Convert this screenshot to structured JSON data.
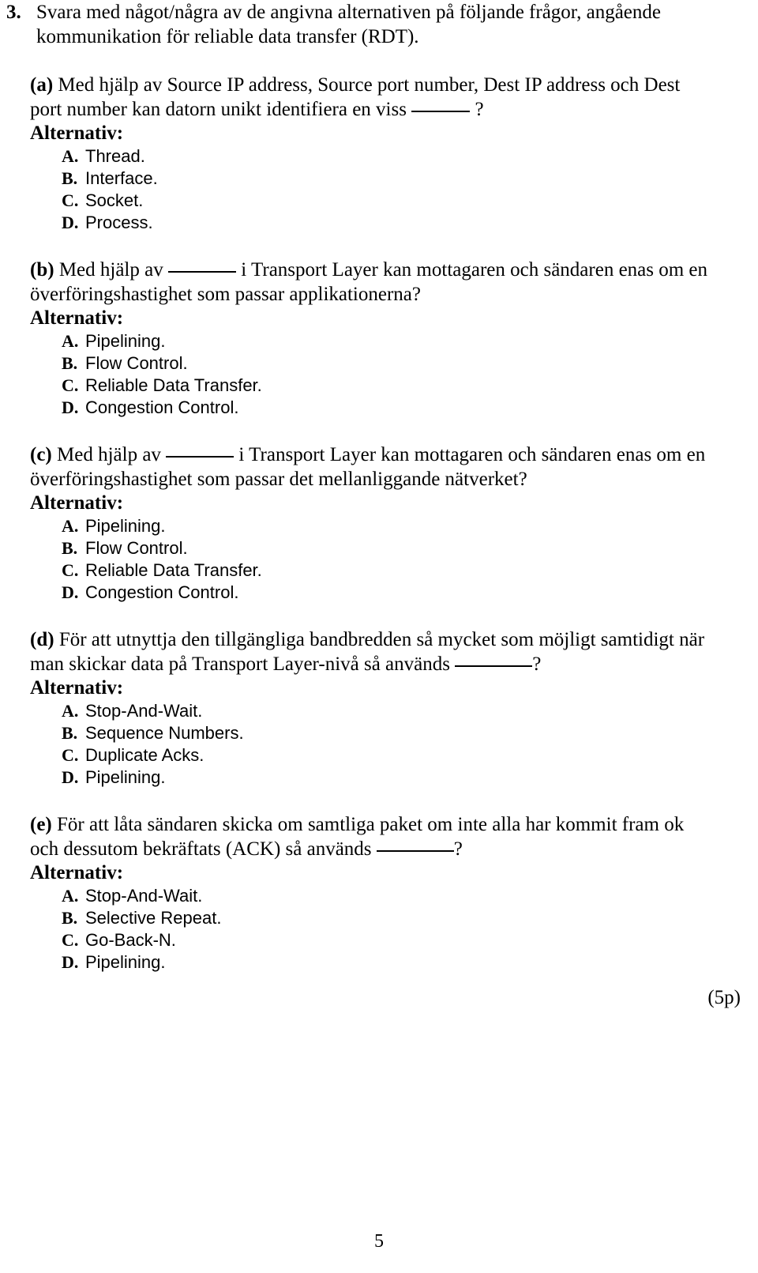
{
  "question": {
    "number": "3.",
    "stem_line1": "Svara med något/några av de angivna alternativen på följande frågor, angående",
    "stem_line2": "kommunikation för reliable data transfer (RDT)."
  },
  "alternativ_label": "Alternativ:",
  "subquestions": [
    {
      "label": "(a)",
      "text_before_blank": " Med hjälp av Source IP address, Source port number, Dest IP address och Dest port number kan datorn unikt identifiera en viss ",
      "text_after_blank": " ?",
      "options": [
        {
          "letter": "A.",
          "text": "Thread."
        },
        {
          "letter": "B.",
          "text": "Interface."
        },
        {
          "letter": "C.",
          "text": "Socket."
        },
        {
          "letter": "D.",
          "text": "Process."
        }
      ]
    },
    {
      "label": "(b)",
      "text_before_blank": " Med hjälp av ",
      "text_after_blank": " i Transport Layer kan mottagaren och sändaren enas om en överföringshastighet som passar applikationerna?",
      "options": [
        {
          "letter": "A.",
          "text": "Pipelining."
        },
        {
          "letter": "B.",
          "text": "Flow Control."
        },
        {
          "letter": "C.",
          "text": "Reliable Data Transfer."
        },
        {
          "letter": "D.",
          "text": "Congestion Control."
        }
      ]
    },
    {
      "label": "(c)",
      "text_before_blank": " Med hjälp av ",
      "text_after_blank": " i Transport Layer kan mottagaren och sändaren enas om en överföringshastighet som passar det mellanliggande nätverket?",
      "options": [
        {
          "letter": "A.",
          "text": "Pipelining."
        },
        {
          "letter": "B.",
          "text": "Flow Control."
        },
        {
          "letter": "C.",
          "text": "Reliable Data Transfer."
        },
        {
          "letter": "D.",
          "text": "Congestion Control."
        }
      ]
    },
    {
      "label": "(d)",
      "text_before_blank": " För att utnyttja den tillgängliga bandbredden så mycket som möjligt samtidigt när man skickar data på Transport Layer-nivå så används ",
      "text_after_blank": "?",
      "options": [
        {
          "letter": "A.",
          "text": "Stop-And-Wait."
        },
        {
          "letter": "B.",
          "text": "Sequence Numbers."
        },
        {
          "letter": "C.",
          "text": "Duplicate Acks."
        },
        {
          "letter": "D.",
          "text": "Pipelining."
        }
      ]
    },
    {
      "label": "(e)",
      "text_before_blank": " För att låta sändaren skicka om samtliga paket om inte alla har kommit fram ok och dessutom bekräftats (ACK) så används ",
      "text_after_blank": "?",
      "options": [
        {
          "letter": "A.",
          "text": "Stop-And-Wait."
        },
        {
          "letter": "B.",
          "text": "Selective Repeat."
        },
        {
          "letter": "C.",
          "text": "Go-Back-N."
        },
        {
          "letter": "D.",
          "text": "Pipelining."
        }
      ]
    }
  ],
  "points_marker": "(5p)",
  "page_number": "5"
}
